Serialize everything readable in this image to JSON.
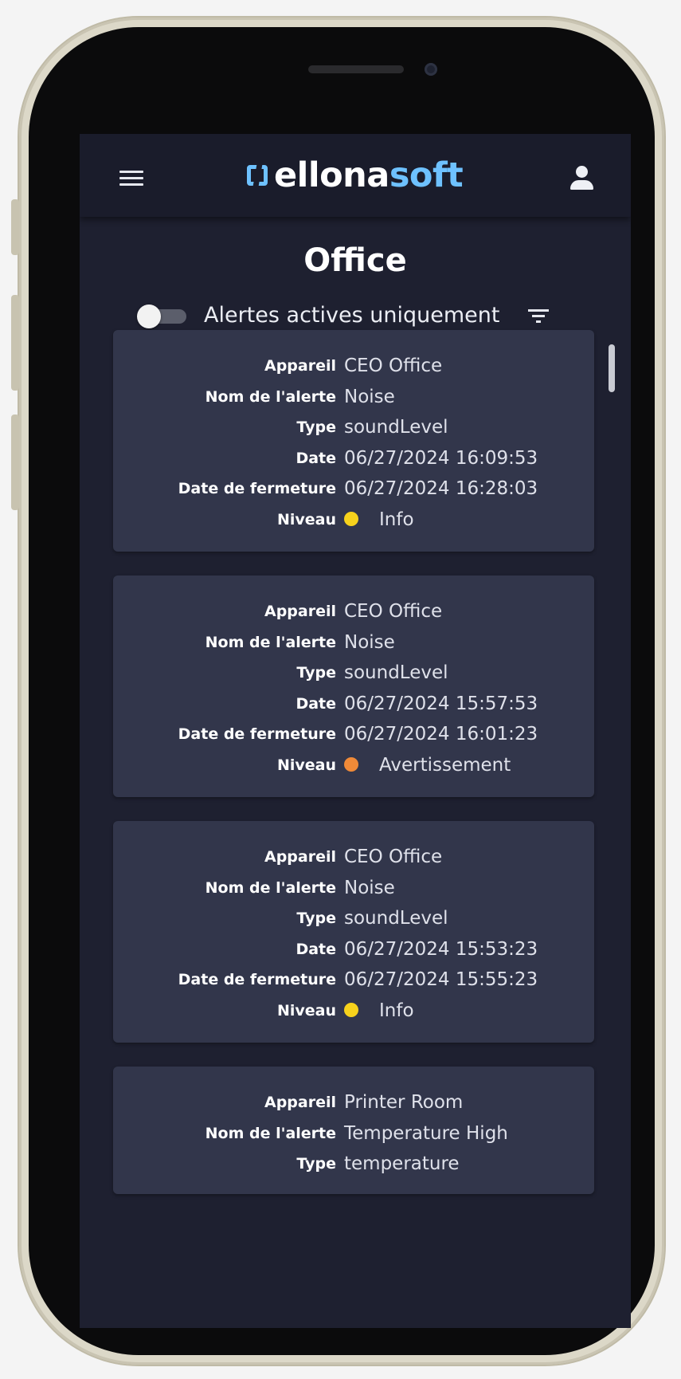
{
  "app": {
    "logo_part1": "ellona",
    "logo_part2": "soft"
  },
  "page": {
    "title": "Office"
  },
  "filter": {
    "toggle_label": "Alertes actives uniquement",
    "toggle_on": false
  },
  "labels": {
    "device": "Appareil",
    "alert_name": "Nom de l'alerte",
    "type": "Type",
    "date": "Date",
    "close_date": "Date de fermeture",
    "level": "Niveau"
  },
  "colors": {
    "info": "#f7d21c",
    "warning": "#f08a38",
    "accent": "#6ec1ff",
    "card": "#32364b",
    "background": "#1e2030"
  },
  "icons": {
    "menu": "hamburger-menu-icon",
    "user": "user-account-icon",
    "filter": "filter-list-icon"
  },
  "alerts": [
    {
      "device": "CEO Office",
      "alert_name": "Noise",
      "type": "soundLevel",
      "date": "06/27/2024 16:09:53",
      "close_date": "06/27/2024 16:28:03",
      "level": "Info",
      "level_color": "#f7d21c"
    },
    {
      "device": "CEO Office",
      "alert_name": "Noise",
      "type": "soundLevel",
      "date": "06/27/2024 15:57:53",
      "close_date": "06/27/2024 16:01:23",
      "level": "Avertissement",
      "level_color": "#f08a38"
    },
    {
      "device": "CEO Office",
      "alert_name": "Noise",
      "type": "soundLevel",
      "date": "06/27/2024 15:53:23",
      "close_date": "06/27/2024 15:55:23",
      "level": "Info",
      "level_color": "#f7d21c"
    },
    {
      "device": "Printer Room",
      "alert_name": "Temperature High",
      "type": "temperature"
    }
  ]
}
